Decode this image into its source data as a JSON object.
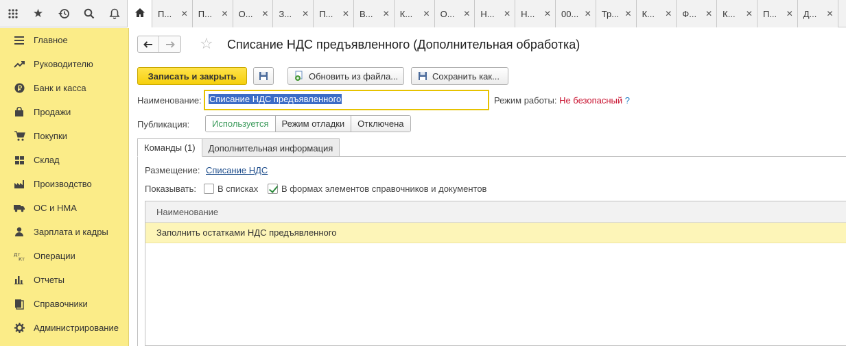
{
  "tabs": [
    {
      "label": "П..."
    },
    {
      "label": "П..."
    },
    {
      "label": "О..."
    },
    {
      "label": "З..."
    },
    {
      "label": "П..."
    },
    {
      "label": "В..."
    },
    {
      "label": "К..."
    },
    {
      "label": "О..."
    },
    {
      "label": "Н..."
    },
    {
      "label": "Н..."
    },
    {
      "label": "00..."
    },
    {
      "label": "Тр..."
    },
    {
      "label": "К..."
    },
    {
      "label": "Ф..."
    },
    {
      "label": "К..."
    },
    {
      "label": "П..."
    },
    {
      "label": "Д..."
    }
  ],
  "sidebar": {
    "items": [
      {
        "label": "Главное",
        "icon": "menu-lines-icon"
      },
      {
        "label": "Руководителю",
        "icon": "trend-icon"
      },
      {
        "label": "Банк и касса",
        "icon": "ruble-coin-icon"
      },
      {
        "label": "Продажи",
        "icon": "shopping-bag-icon"
      },
      {
        "label": "Покупки",
        "icon": "cart-icon"
      },
      {
        "label": "Склад",
        "icon": "warehouse-grid-icon"
      },
      {
        "label": "Производство",
        "icon": "factory-icon"
      },
      {
        "label": "ОС и НМА",
        "icon": "truck-icon"
      },
      {
        "label": "Зарплата и кадры",
        "icon": "person-icon"
      },
      {
        "label": "Операции",
        "icon": "debit-credit-icon"
      },
      {
        "label": "Отчеты",
        "icon": "bar-chart-icon"
      },
      {
        "label": "Справочники",
        "icon": "books-icon"
      },
      {
        "label": "Администрирование",
        "icon": "gear-icon"
      }
    ]
  },
  "form": {
    "title": "Списание НДС предъявленного (Дополнительная обработка)",
    "save_close_label": "Записать и закрыть",
    "update_from_file_label": "Обновить из файла...",
    "save_as_label": "Сохранить как...",
    "name_label": "Наименование:",
    "name_value": "Списание НДС предъявленного",
    "mode_label": "Режим работы:",
    "mode_value": "Не безопасный",
    "mode_help": "?",
    "publication_label": "Публикация:",
    "publication_options": [
      "Используется",
      "Режим отладки",
      "Отключена"
    ],
    "publication_selected": "Используется",
    "tabs": [
      {
        "label": "Команды (1)",
        "active": true
      },
      {
        "label": "Дополнительная информация",
        "active": false
      }
    ],
    "placement_label": "Размещение:",
    "placement_value": "Списание НДС",
    "show_label": "Показывать:",
    "show_in_lists_label": "В списках",
    "show_in_lists_checked": false,
    "show_in_forms_label": "В формах элементов справочников и документов",
    "show_in_forms_checked": true,
    "table": {
      "header": "Наименование",
      "rows": [
        "Заполнить остатками НДС предъявленного"
      ]
    }
  },
  "colors": {
    "sidebar_bg": "#fbec88",
    "primary_button": "#f5cf0c",
    "warning_text": "#c8102e",
    "link": "#1f4e8c"
  }
}
